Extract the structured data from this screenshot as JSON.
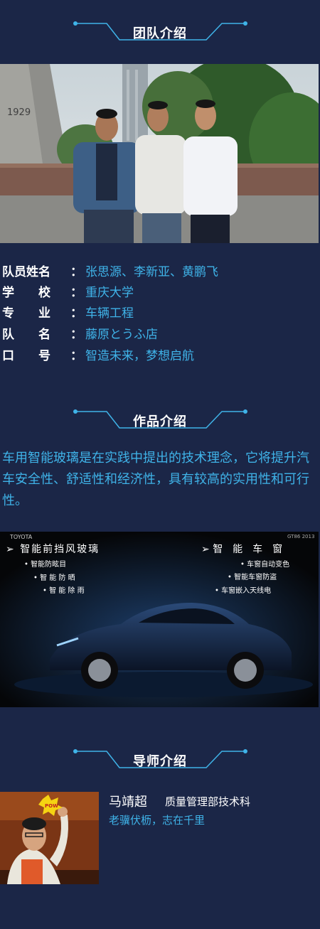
{
  "colors": {
    "background": "#1b2647",
    "accent": "#3fb3e8",
    "text": "#ffffff"
  },
  "team": {
    "title": "团队介绍",
    "rows": [
      {
        "key": "队员姓名",
        "value": "张思源、李新亚、黄鹏飞"
      },
      {
        "key": "学　　校",
        "value": "重庆大学"
      },
      {
        "key": "专　　业",
        "value": "车辆工程"
      },
      {
        "key": "队　　名",
        "value": "藤原とうふ店"
      },
      {
        "key": "口　　号",
        "value": "智造未来，梦想启航"
      }
    ]
  },
  "work": {
    "title": "作品介绍",
    "description": "车用智能玻璃是在实践中提出的技术理念，它将提升汽车安全性、舒适性和经济性，具有较高的实用性和可行性。",
    "poster": {
      "brand": "TOYOTA",
      "badge": "GT86 2013",
      "left_heading": "智能前挡风玻璃",
      "left_items": [
        "智能防眩目",
        "智 能 防 晒",
        "智 能 除 雨"
      ],
      "right_heading": "智　能　车　窗",
      "right_items": [
        "车窗自动变色",
        "智能车窗防盗",
        "车窗嵌入天线电"
      ]
    }
  },
  "mentor": {
    "title": "导师介绍",
    "name": "马靖超",
    "department": "质量管理部技术科",
    "motto": "老骥伏枥，志在千里"
  }
}
